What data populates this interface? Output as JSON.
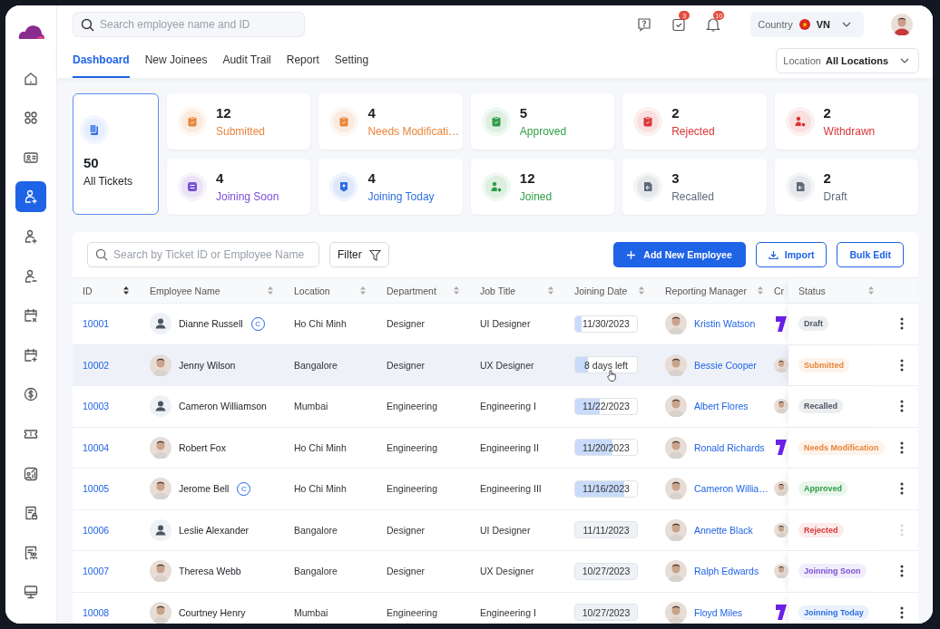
{
  "sidebar": {
    "items": [
      {
        "kind": "home",
        "selected": false
      },
      {
        "kind": "grid",
        "selected": false
      },
      {
        "kind": "id-card",
        "selected": false
      },
      {
        "kind": "user-plus",
        "selected": true
      },
      {
        "kind": "user-plus",
        "selected": false
      },
      {
        "kind": "user-minus",
        "selected": false
      },
      {
        "kind": "calendar-x",
        "selected": false
      },
      {
        "kind": "calendar-plus",
        "selected": false
      },
      {
        "kind": "dollar",
        "selected": false
      },
      {
        "kind": "ticket",
        "selected": false
      },
      {
        "kind": "chart-user",
        "selected": false
      },
      {
        "kind": "doc-lock",
        "selected": false
      },
      {
        "kind": "doc-users",
        "selected": false
      },
      {
        "kind": "monitor",
        "selected": false
      }
    ]
  },
  "header": {
    "search": {
      "placeholder": "Search employee name and ID"
    },
    "task_badge": "3",
    "notification_badge": "10",
    "country": {
      "label": "Country",
      "value": "VN"
    }
  },
  "tabs": [
    {
      "label": "Dashboard",
      "selected": true
    },
    {
      "label": "New Joinees",
      "selected": false
    },
    {
      "label": "Audit Trail",
      "selected": false
    },
    {
      "label": "Report",
      "selected": false
    },
    {
      "label": "Setting",
      "selected": false
    }
  ],
  "location": {
    "label": "Location",
    "value": "All Locations"
  },
  "all_tickets": {
    "count": "50",
    "label": "All Tickets"
  },
  "stats": [
    {
      "count": "12",
      "label": "Submitted",
      "color": "#e8853a"
    },
    {
      "count": "4",
      "label": "Needs Modificati…",
      "color": "#e8853a"
    },
    {
      "count": "5",
      "label": "Approved",
      "color": "#2e9e45"
    },
    {
      "count": "2",
      "label": "Rejected",
      "color": "#d93636"
    },
    {
      "count": "2",
      "label": "Withdrawn",
      "color": "#d93636"
    },
    {
      "count": "4",
      "label": "Joining Soon",
      "color": "#7a4fd6"
    },
    {
      "count": "4",
      "label": "Joining Today",
      "color": "#2f6fe0"
    },
    {
      "count": "12",
      "label": "Joined",
      "color": "#2e9e45"
    },
    {
      "count": "3",
      "label": "Recalled",
      "color": "#5f6b7a"
    },
    {
      "count": "2",
      "label": "Draft",
      "color": "#5f6b7a"
    }
  ],
  "toolbar": {
    "search": {
      "placeholder": "Search by Ticket ID or Employee Name"
    },
    "filter": "Filter",
    "add": "Add New Employee",
    "import": "Import",
    "bulk_edit": "Bulk Edit"
  },
  "table": {
    "columns": [
      "ID",
      "Employee Name",
      "Location",
      "Department",
      "Job Title",
      "Joining Date",
      "Reporting Manager",
      "Cr",
      "Status"
    ],
    "rows": [
      {
        "id": "10001",
        "avatar": {
          "kind": "placeholder"
        },
        "name": "Dianne Russell",
        "badge": "C",
        "location": "Ho Chi Minh",
        "department": "Designer",
        "job_title": "UI Designer",
        "joining": "11/30/2023",
        "level": 0.1,
        "passed": false,
        "manager": "Kristin Watson",
        "column_8": {
          "kind": "logo"
        },
        "status": "Draft",
        "color": "#4b5563",
        "hovered": false,
        "menu_disabled": false,
        "cursor": false
      },
      {
        "id": "10002",
        "avatar": {
          "kind": "photo"
        },
        "name": "Jenny Wilson",
        "location": "Bangalore",
        "department": "Designer",
        "job_title": "UX Designer",
        "joining": "8 days left",
        "level": 0.2,
        "passed": false,
        "manager": "Bessie Cooper",
        "column_8": {
          "kind": "photo"
        },
        "status": "Submitted",
        "color": "#e8853a",
        "hovered": true,
        "menu_disabled": false,
        "cursor": true
      },
      {
        "id": "10003",
        "avatar": {
          "kind": "placeholder"
        },
        "name": "Cameron Williamson",
        "location": "Mumbai",
        "department": "Engineering",
        "job_title": "Engineering I",
        "joining": "11/22/2023",
        "level": 0.4,
        "passed": false,
        "manager": "Albert Flores",
        "column_8": {
          "kind": "photo"
        },
        "status": "Recalled",
        "color": "#4b5563",
        "hovered": false,
        "menu_disabled": false,
        "cursor": false
      },
      {
        "id": "10004",
        "avatar": {
          "kind": "photo"
        },
        "name": "Robert Fox",
        "location": "Ho Chi Minh",
        "department": "Engineering",
        "job_title": "Engineering II",
        "joining": "11/20/2023",
        "level": 0.6,
        "passed": false,
        "manager": "Ronald Richards",
        "column_8": {
          "kind": "logo"
        },
        "status": "Needs Modification",
        "color": "#e8853a",
        "hovered": false,
        "menu_disabled": false,
        "cursor": false
      },
      {
        "id": "10005",
        "avatar": {
          "kind": "photo"
        },
        "name": "Jerome Bell",
        "badge": "C",
        "location": "Ho Chi Minh",
        "department": "Engineering",
        "job_title": "Engineering III",
        "joining": "11/16/2023",
        "level": 0.8,
        "passed": false,
        "manager": "Cameron Willia…",
        "column_8": {
          "kind": "photo"
        },
        "status": "Approved",
        "color": "#2e9e45",
        "hovered": false,
        "menu_disabled": false,
        "cursor": false
      },
      {
        "id": "10006",
        "avatar": {
          "kind": "placeholder"
        },
        "name": "Leslie Alexander",
        "location": "Bangalore",
        "department": "Designer",
        "job_title": "UI Designer",
        "joining": "11/11/2023",
        "level": 1,
        "passed": true,
        "manager": "Annette Black",
        "column_8": {
          "kind": "photo"
        },
        "status": "Rejected",
        "color": "#d93636",
        "hovered": false,
        "menu_disabled": true,
        "cursor": false
      },
      {
        "id": "10007",
        "avatar": {
          "kind": "photo"
        },
        "name": "Theresa Webb",
        "location": "Bangalore",
        "department": "Designer",
        "job_title": "UX Designer",
        "joining": "10/27/2023",
        "level": 1,
        "passed": true,
        "manager": "Ralph Edwards",
        "column_8": {
          "kind": "photo"
        },
        "status": "Joinning Soon",
        "color": "#7a4fd6",
        "hovered": false,
        "menu_disabled": false,
        "cursor": false
      },
      {
        "id": "10008",
        "avatar": {
          "kind": "photo"
        },
        "name": "Courtney Henry",
        "location": "Mumbai",
        "department": "Engineering",
        "job_title": "Engineering I",
        "joining": "10/27/2023",
        "level": 1,
        "passed": true,
        "manager": "Floyd Miles",
        "column_8": {
          "kind": "logo"
        },
        "status": "Joinning Today",
        "color": "#2f6fe0",
        "hovered": false,
        "menu_disabled": false,
        "cursor": false
      }
    ]
  }
}
